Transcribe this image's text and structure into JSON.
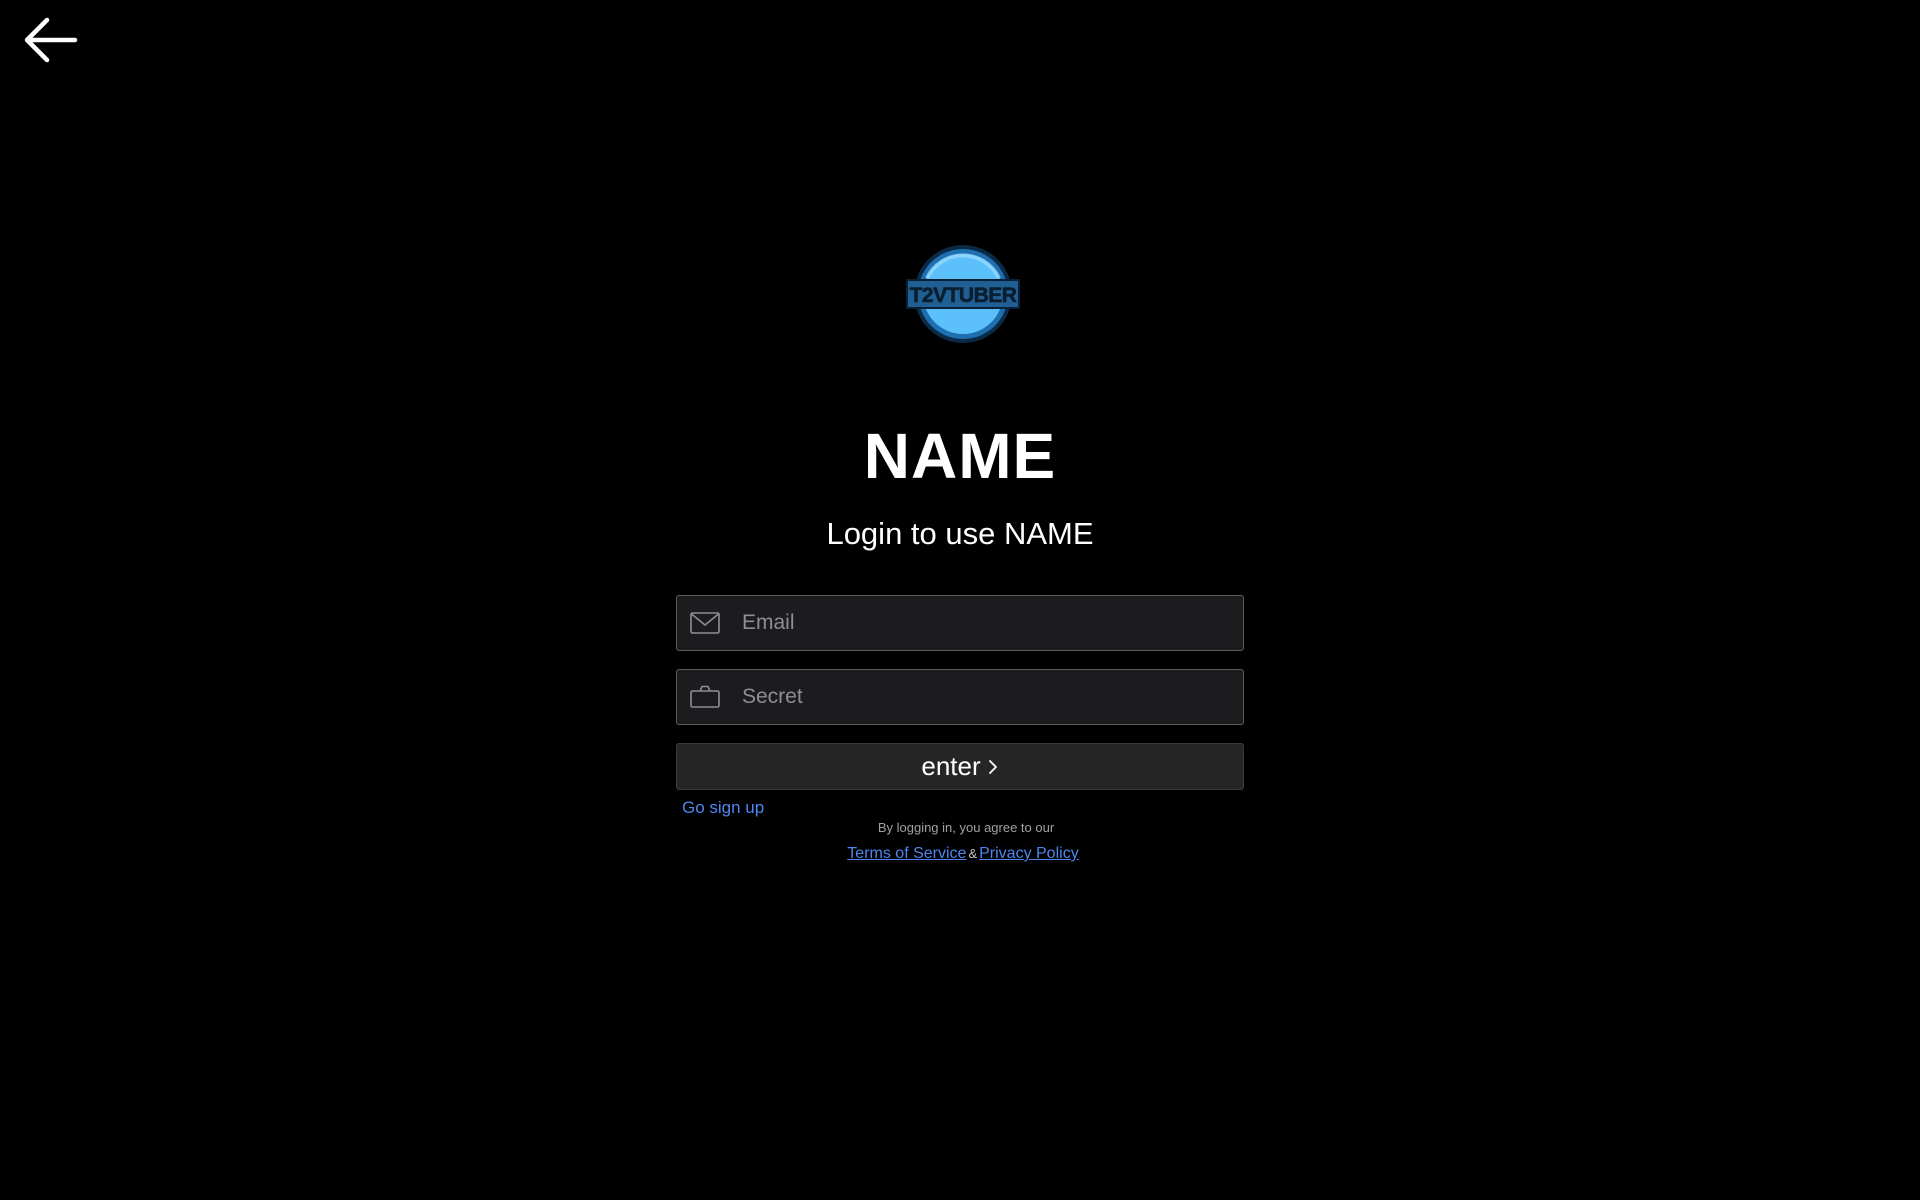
{
  "header": {
    "back_icon": "arrow-left-icon"
  },
  "brand": {
    "logo_text": "T2VTUBER",
    "logo_color": "#4db8f5",
    "title": "NAME",
    "subtitle": "Login to use NAME"
  },
  "form": {
    "email": {
      "placeholder": "Email",
      "value": "",
      "icon": "mail-icon"
    },
    "secret": {
      "placeholder": "Secret",
      "value": "",
      "icon": "briefcase-icon"
    },
    "enter_label": "enter",
    "enter_icon": "chevron-right-icon"
  },
  "links": {
    "signup": "Go sign up",
    "agree_text": "By logging in, you agree to our",
    "terms": "Terms of Service",
    "separator": "&",
    "privacy": "Privacy Policy",
    "link_color": "#4d86f0"
  }
}
